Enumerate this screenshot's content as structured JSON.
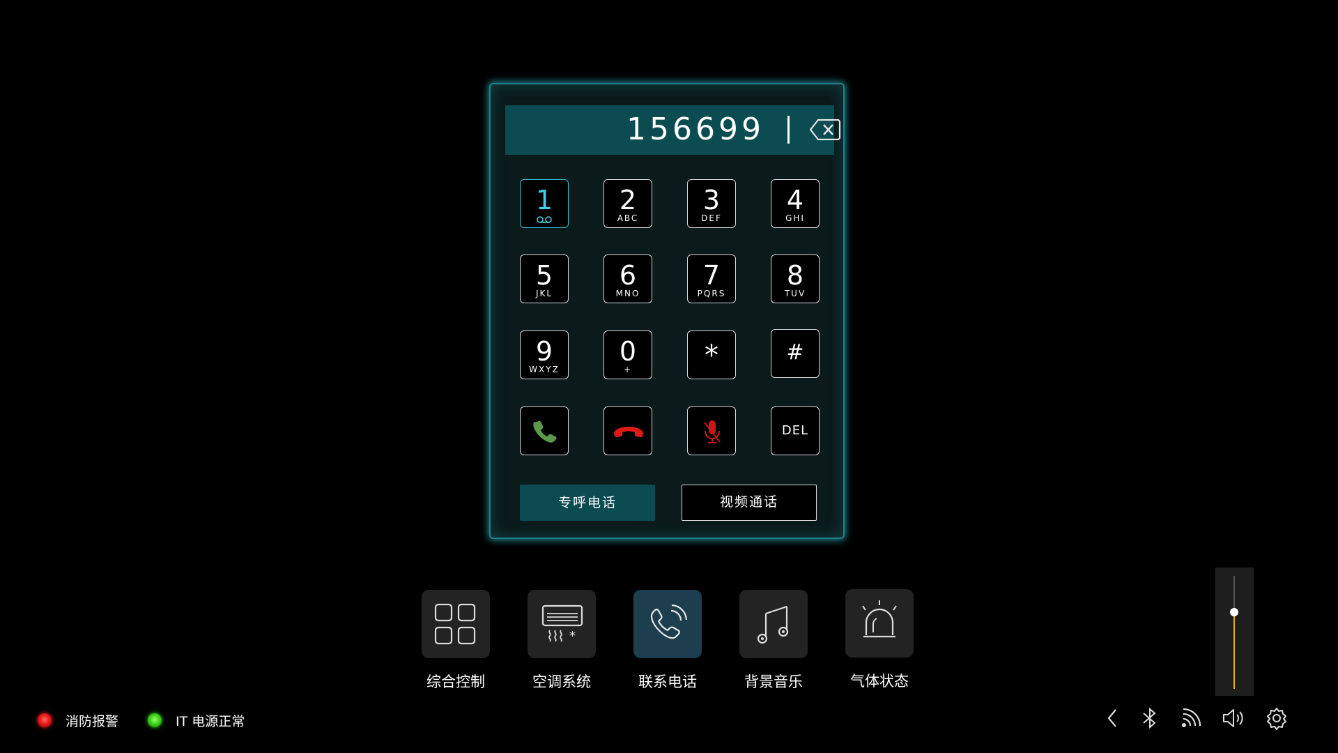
{
  "dialer": {
    "number": "156699",
    "keys": [
      {
        "digit": "1",
        "letters": ""
      },
      {
        "digit": "2",
        "letters": "ABC"
      },
      {
        "digit": "3",
        "letters": "DEF"
      },
      {
        "digit": "4",
        "letters": "GHI"
      },
      {
        "digit": "5",
        "letters": "JKL"
      },
      {
        "digit": "6",
        "letters": "MNO"
      },
      {
        "digit": "7",
        "letters": "PQRS"
      },
      {
        "digit": "8",
        "letters": "TUV"
      },
      {
        "digit": "9",
        "letters": "WXYZ"
      },
      {
        "digit": "0",
        "letters": "+"
      },
      {
        "digit": "*",
        "letters": ""
      },
      {
        "digit": "#",
        "letters": ""
      }
    ],
    "del_label": "DEL",
    "hotline_label": "专呼电话",
    "video_call_label": "视频通话"
  },
  "dock": {
    "items": [
      {
        "label": "综合控制",
        "icon": "grid-icon"
      },
      {
        "label": "空调系统",
        "icon": "air-conditioner-icon"
      },
      {
        "label": "联系电话",
        "icon": "phone-ringing-icon",
        "selected": true
      },
      {
        "label": "背景音乐",
        "icon": "music-note-icon"
      },
      {
        "label": "气体状态",
        "icon": "alarm-siren-icon"
      }
    ]
  },
  "volume": {
    "level": 0.68
  },
  "status": {
    "fire_alarm": "消防报警",
    "it_power": "IT 电源正常"
  },
  "system_icons": [
    "back-chevron-icon",
    "bluetooth-icon",
    "wireless-icon",
    "speaker-icon",
    "gear-icon"
  ],
  "colors": {
    "accent": "#0b4b52",
    "panel_glow": "#28aab4",
    "active_key": "#3fd2e4",
    "call_green": "#5a9a4a",
    "hangup_red": "#e01818",
    "volume_fill": "#e0b01c"
  }
}
